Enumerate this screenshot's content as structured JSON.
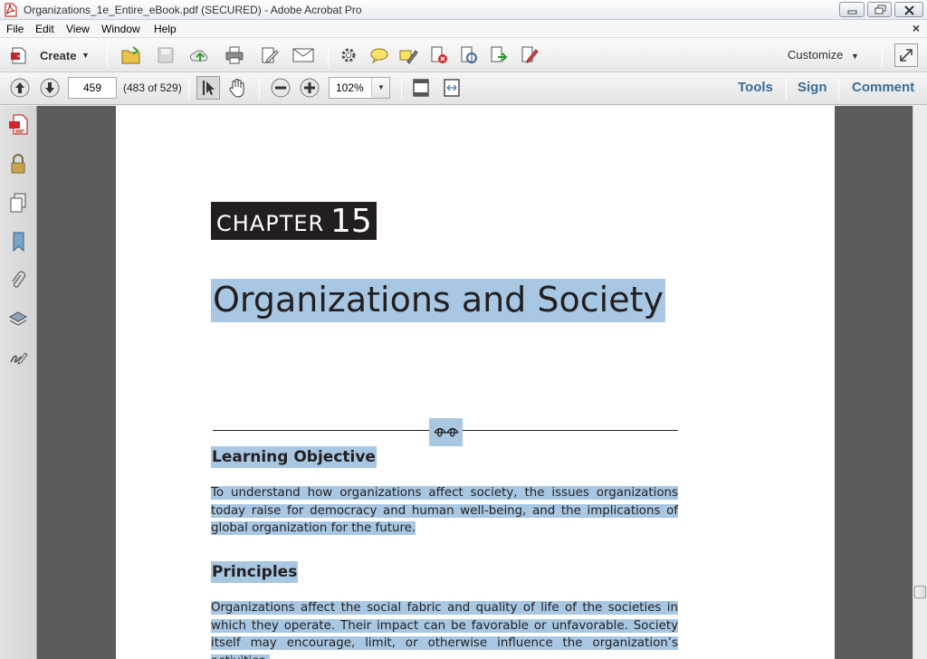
{
  "window": {
    "title": "Organizations_1e_Entire_eBook.pdf (SECURED) - Adobe Acrobat Pro"
  },
  "menu": [
    "File",
    "Edit",
    "View",
    "Window",
    "Help"
  ],
  "toolbar": {
    "create_label": "Create",
    "customize_label": "Customize"
  },
  "navigation": {
    "current_page": "459",
    "page_count": "(483 of 529)",
    "zoom": "102%"
  },
  "panes": {
    "tools": "Tools",
    "sign": "Sign",
    "comment": "Comment"
  },
  "document": {
    "chapter_word": "CHAPTER",
    "chapter_number": "15",
    "chapter_title": "Organizations and Society",
    "learning_objective_heading": "Learning Objective",
    "learning_objective_text": "To understand how organizations affect society, the issues organizations today raise for democracy and human well-being, and the implications of global organization for the future.",
    "principles_heading": "Principles",
    "principles_text": "Organizations affect the social fabric and quality of life of the societies in which they operate. Their impact can be favorable or unfavorable. Society itself may encourage, limit, or otherwise influence the organization’s activities."
  },
  "colors": {
    "selection": "#a8c7e2",
    "pane_link": "#3a6d96",
    "chapter_box": "#231f20",
    "document_background": "#5b5b5b"
  }
}
